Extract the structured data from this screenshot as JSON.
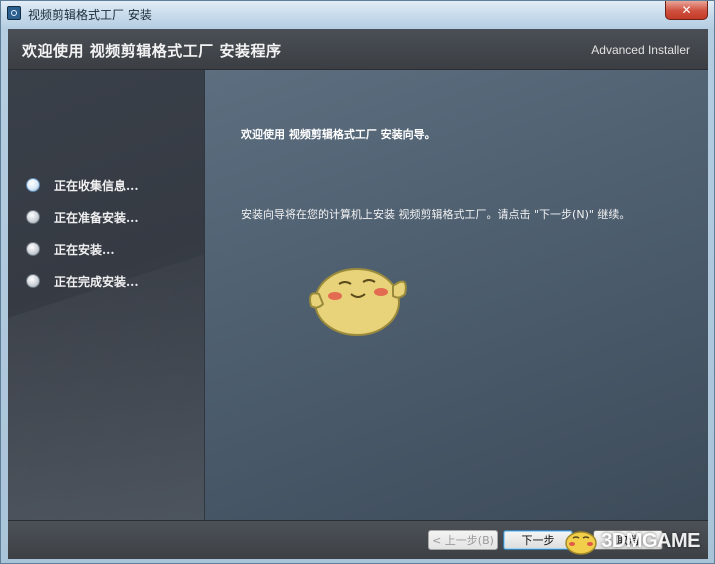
{
  "window": {
    "title": "视频剪辑格式工厂 安装",
    "close_label": "✕"
  },
  "header": {
    "title": "欢迎使用 视频剪辑格式工厂 安装程序",
    "brand": "Advanced Installer"
  },
  "steps": [
    {
      "label": "正在收集信息...",
      "active": true
    },
    {
      "label": "正在准备安装...",
      "active": false
    },
    {
      "label": "正在安装...",
      "active": false
    },
    {
      "label": "正在完成安装...",
      "active": false
    }
  ],
  "main": {
    "heading": "欢迎使用 视频剪辑格式工厂 安装向导。",
    "body": "安装向导将在您的计算机上安装 视频剪辑格式工厂。请点击 \"下一步(N)\" 继续。"
  },
  "footer": {
    "back_label": "< 上一步(B)",
    "next_label": "下一步",
    "cancel_label": "取消"
  },
  "watermark": {
    "text": "3DMGAME"
  },
  "colors": {
    "header_bg": "#3e4247",
    "sidebar_bg": "#383e47",
    "content_bg": "#52636f",
    "accent": "#3c7fb1"
  }
}
